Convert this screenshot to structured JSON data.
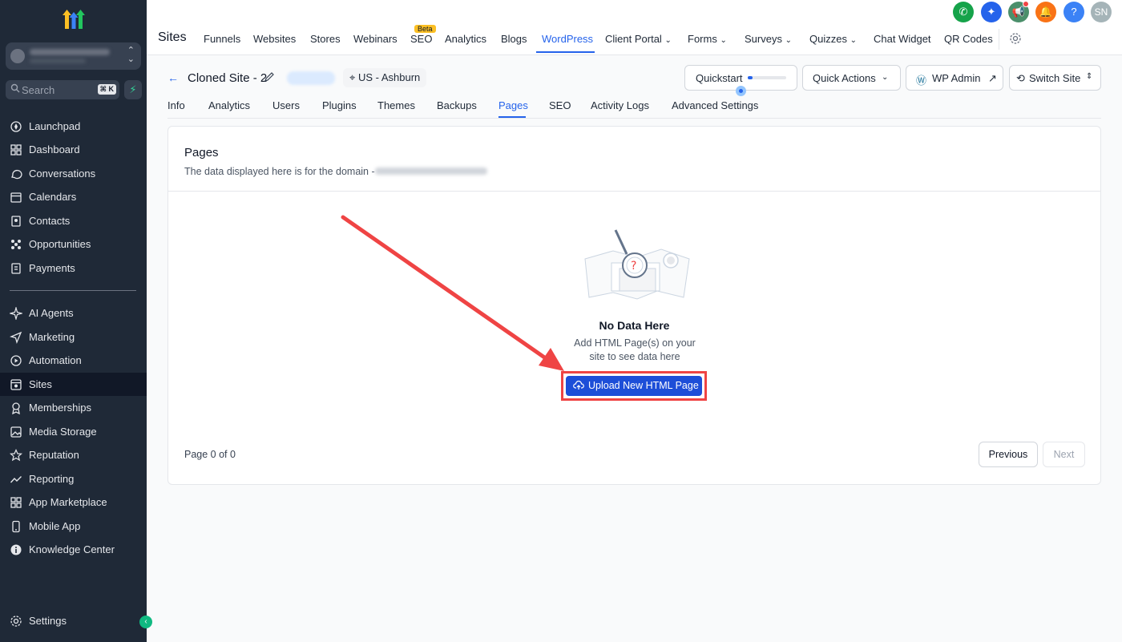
{
  "sidebar": {
    "search_placeholder": "Search",
    "search_shortcut": "⌘ K",
    "items": [
      {
        "label": "Launchpad",
        "icon": "launchpad-icon"
      },
      {
        "label": "Dashboard",
        "icon": "dashboard-icon"
      },
      {
        "label": "Conversations",
        "icon": "chat-icon"
      },
      {
        "label": "Calendars",
        "icon": "calendar-icon"
      },
      {
        "label": "Contacts",
        "icon": "contacts-icon"
      },
      {
        "label": "Opportunities",
        "icon": "opportunities-icon"
      },
      {
        "label": "Payments",
        "icon": "payments-icon"
      },
      {
        "label": "AI Agents",
        "icon": "sparkle-icon"
      },
      {
        "label": "Marketing",
        "icon": "send-icon"
      },
      {
        "label": "Automation",
        "icon": "automation-icon"
      },
      {
        "label": "Sites",
        "icon": "sites-icon"
      },
      {
        "label": "Memberships",
        "icon": "memberships-icon"
      },
      {
        "label": "Media Storage",
        "icon": "image-icon"
      },
      {
        "label": "Reputation",
        "icon": "star-icon"
      },
      {
        "label": "Reporting",
        "icon": "trend-icon"
      },
      {
        "label": "App Marketplace",
        "icon": "grid-icon"
      },
      {
        "label": "Mobile App",
        "icon": "mobile-icon"
      },
      {
        "label": "Knowledge Center",
        "icon": "info-icon"
      }
    ],
    "settings_label": "Settings",
    "active": "Sites"
  },
  "topbar": {
    "title": "Sites",
    "nav": [
      "Funnels",
      "Websites",
      "Stores",
      "Webinars",
      "SEO",
      "Analytics",
      "Blogs",
      "WordPress",
      "Client Portal",
      "Forms",
      "Surveys",
      "Quizzes",
      "Chat Widget",
      "QR Codes"
    ],
    "active": "WordPress",
    "beta_badge": "Beta",
    "avatar_initials": "SN"
  },
  "site": {
    "name": "Cloned Site - 2",
    "location": "US - Ashburn",
    "quickstart_label": "Quickstart",
    "quickstart_progress": 0.12,
    "quick_actions_label": "Quick Actions",
    "wp_admin_label": "WP Admin",
    "switch_site_label": "Switch Site"
  },
  "subtabs": [
    "Info",
    "Analytics",
    "Users",
    "Plugins",
    "Themes",
    "Backups",
    "Pages",
    "SEO",
    "Activity Logs",
    "Advanced Settings"
  ],
  "subtab_active": "Pages",
  "pages_card": {
    "title": "Pages",
    "description": "The data displayed here is for the domain -",
    "empty_title": "No Data Here",
    "empty_desc": "Add HTML Page(s) on your site to see data here",
    "upload_label": "Upload New HTML Page",
    "page_info": "Page 0 of 0",
    "previous_label": "Previous",
    "next_label": "Next"
  },
  "colors": {
    "sidebar_bg": "#1f2937",
    "accent": "#2563eb",
    "annotation_red": "#ef4444"
  }
}
